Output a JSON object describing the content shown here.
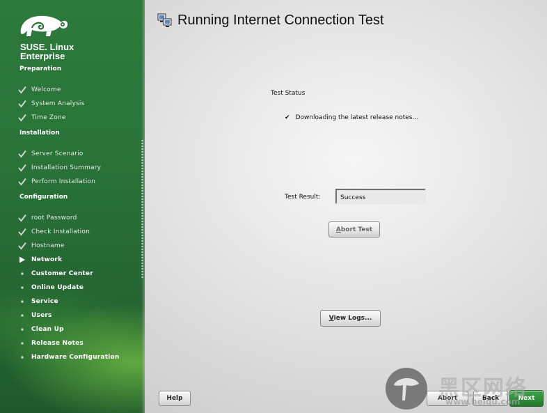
{
  "brand": {
    "line1": "SUSE. Linux",
    "line2": "Enterprise"
  },
  "sections": {
    "preparation": "Preparation",
    "installation": "Installation",
    "configuration": "Configuration"
  },
  "steps": [
    {
      "label": "Welcome",
      "state": "done"
    },
    {
      "label": "System Analysis",
      "state": "done"
    },
    {
      "label": "Time Zone",
      "state": "done"
    },
    {
      "label": "Server Scenario",
      "state": "done"
    },
    {
      "label": "Installation Summary",
      "state": "done"
    },
    {
      "label": "Perform Installation",
      "state": "done"
    },
    {
      "label": "root Password",
      "state": "done"
    },
    {
      "label": "Check Installation",
      "state": "done"
    },
    {
      "label": "Hostname",
      "state": "done"
    },
    {
      "label": "Network",
      "state": "current"
    },
    {
      "label": "Customer Center",
      "state": "todo"
    },
    {
      "label": "Online Update",
      "state": "todo"
    },
    {
      "label": "Service",
      "state": "todo"
    },
    {
      "label": "Users",
      "state": "todo"
    },
    {
      "label": "Clean Up",
      "state": "todo"
    },
    {
      "label": "Release Notes",
      "state": "todo"
    },
    {
      "label": "Hardware Configuration",
      "state": "todo"
    }
  ],
  "main": {
    "title": "Running Internet Connection Test",
    "status_label": "Test Status",
    "status_item": "Downloading the latest release notes...",
    "result_label": "Test Result:",
    "result_value": "Success"
  },
  "buttons": {
    "abort_test": {
      "mnemonic": "A",
      "rest": "bort Test"
    },
    "view_logs": {
      "mnemonic": "V",
      "rest": "iew Logs..."
    },
    "help": "Help",
    "abort": "Abort",
    "back": "Back",
    "next": "Next"
  },
  "watermark": {
    "text": "黑区网络",
    "sub": "www.heiqu.com"
  },
  "colors": {
    "sidebar_green": "#2a7439",
    "next_green": "#2d8a38"
  }
}
